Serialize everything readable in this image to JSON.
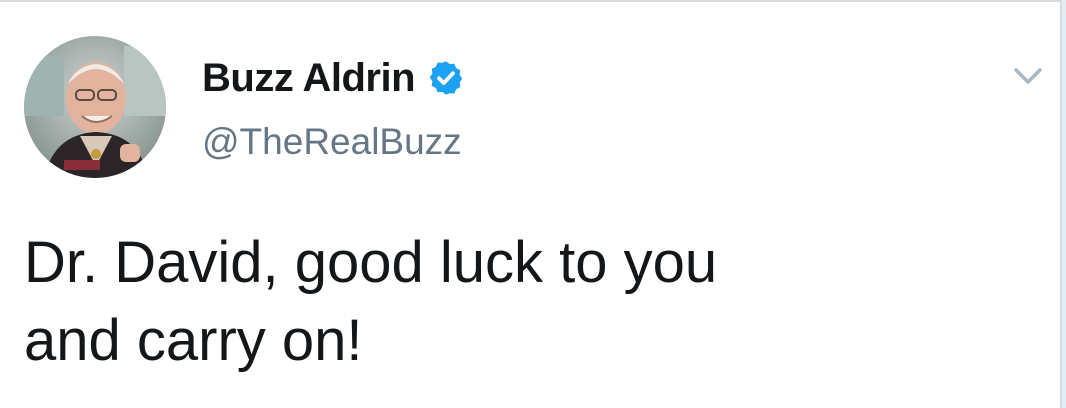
{
  "tweet": {
    "author": {
      "display_name": "Buzz Aldrin",
      "handle": "@TheRealBuzz",
      "verified": true,
      "verified_icon": "verified-badge-icon",
      "avatar": "profile-photo"
    },
    "text_lines": [
      "Dr. David, good luck to you",
      "and carry on!"
    ],
    "menu_icon": "chevron-down-icon",
    "colors": {
      "text": "#14171a",
      "secondary": "#657786",
      "verified": "#1da1f2",
      "caret": "#aab8c2"
    }
  }
}
